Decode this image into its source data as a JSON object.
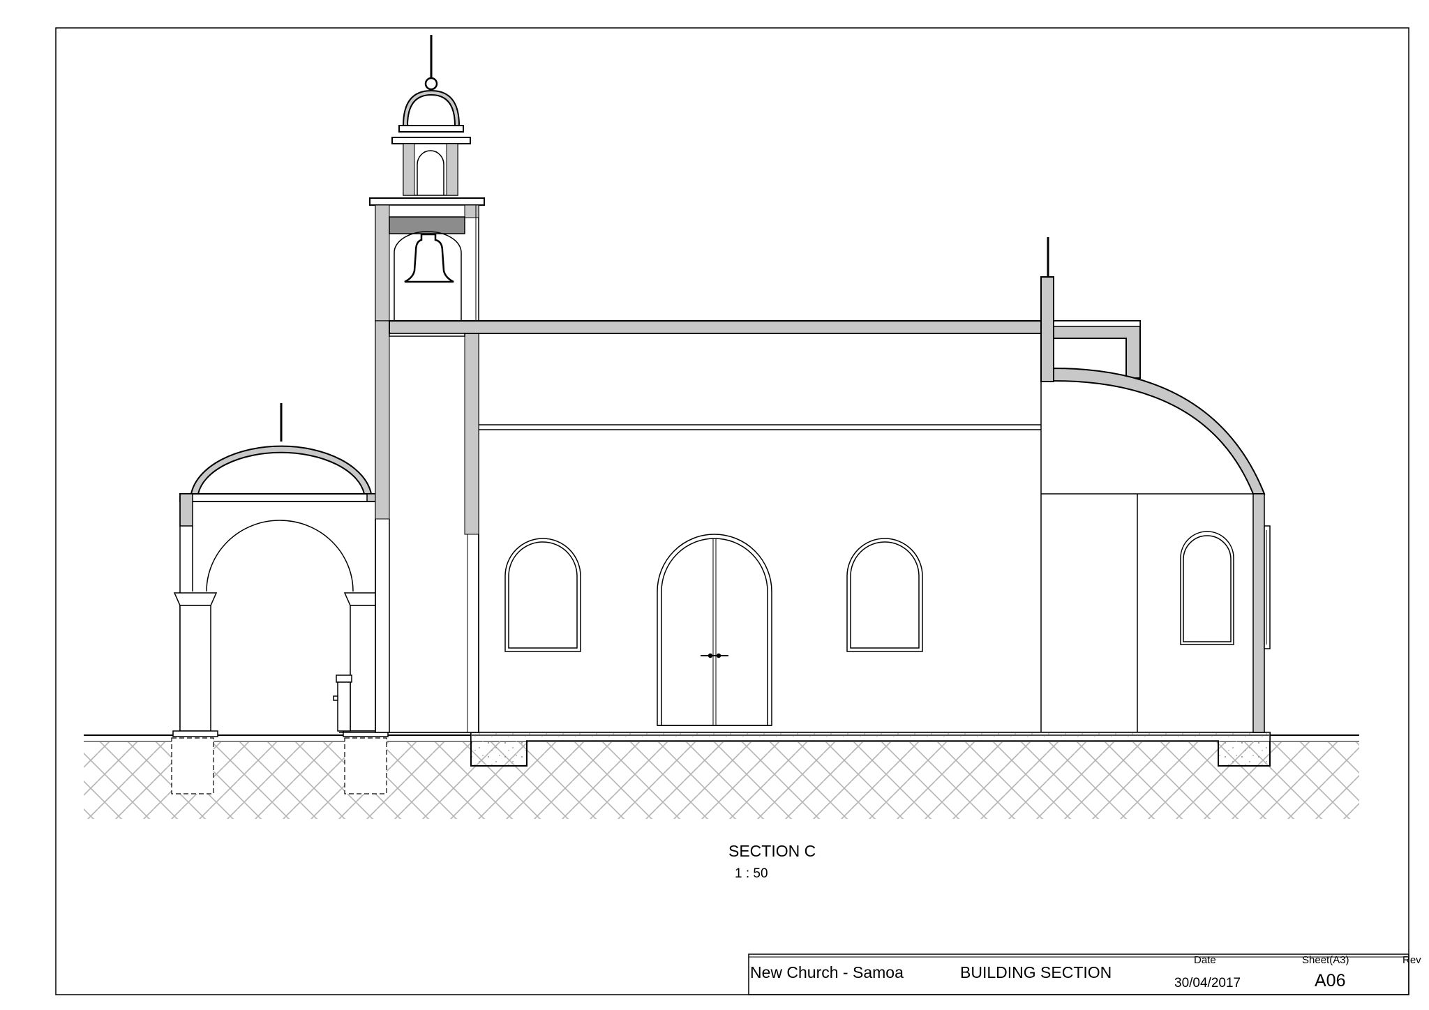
{
  "drawing": {
    "section_title": "SECTION C",
    "section_scale": "1 : 50"
  },
  "title_block": {
    "project": "New Church - Samoa",
    "sheet_title": "BUILDING SECTION",
    "date_label": "Date",
    "date": "30/04/2017",
    "sheet_label": "Sheet(A3)",
    "sheet_number": "A06",
    "rev_label": "Rev",
    "rev": ""
  },
  "colors": {
    "line": "#000000",
    "cut_fill": "#c8c8c8",
    "bell_band": "#8c8c8c",
    "hatch": "#b4b4b4",
    "paper": "#ffffff"
  }
}
